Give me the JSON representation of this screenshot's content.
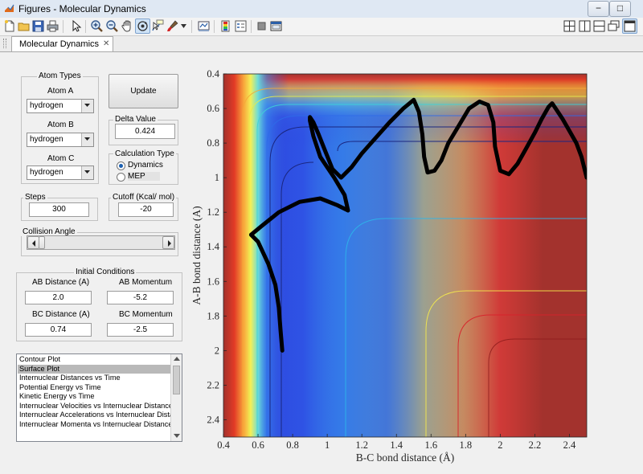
{
  "window": {
    "title": "Figures - Molecular Dynamics",
    "min_label": "−",
    "max_label": "□",
    "close_label": "✕"
  },
  "toolbar": {
    "items": [
      "new-figure-icon",
      "open-icon",
      "save-icon",
      "print-icon",
      "pointer-icon",
      "zoom-in-icon",
      "zoom-out-icon",
      "pan-hand-icon",
      "rotate-3d-icon",
      "data-cursor-icon",
      "brush-icon",
      "link-plot-icon",
      "colorbar-icon",
      "legend-icon",
      "hide-plot-tools-icon",
      "show-plot-tools-icon"
    ],
    "right_items": [
      "tile-icon",
      "left-right-icon",
      "top-bottom-icon",
      "float-icon",
      "dock-icon"
    ]
  },
  "tab": {
    "label": "Molecular Dynamics",
    "close": "✕"
  },
  "atom_types": {
    "title": "Atom Types",
    "atom_a_label": "Atom A",
    "atom_a_value": "hydrogen",
    "atom_b_label": "Atom B",
    "atom_b_value": "hydrogen",
    "atom_c_label": "Atom C",
    "atom_c_value": "hydrogen"
  },
  "update_button": "Update",
  "delta": {
    "title": "Delta Value",
    "value": "0.424"
  },
  "calc_type": {
    "title": "Calculation Type",
    "options": [
      "Dynamics",
      "MEP"
    ],
    "selected": "Dynamics"
  },
  "steps": {
    "title": "Steps",
    "value": "300"
  },
  "cutoff": {
    "title": "Cutoff (Kcal/ mol)",
    "value": "-20"
  },
  "collision": {
    "title": "Collision Angle",
    "slider_fraction": 0.0
  },
  "initial": {
    "title": "Initial Conditions",
    "ab_distance_label": "AB Distance (A)",
    "ab_distance": "2.0",
    "ab_momentum_label": "AB Momentum",
    "ab_momentum": "-5.2",
    "bc_distance_label": "BC Distance (A)",
    "bc_distance": "0.74",
    "bc_momentum_label": "BC Momentum",
    "bc_momentum": "-2.5"
  },
  "plot_list": {
    "items": [
      "Contour Plot",
      "Surface Plot",
      "Internuclear Distances vs Time",
      "Potential Energy vs Time",
      "Kinetic Energy vs Time",
      "Internuclear Velocities vs Internuclear Distances",
      "Internuclear Accelerations vs Internuclear Distances",
      "Internuclear Momenta vs Internuclear Distances"
    ],
    "selected": "Surface Plot"
  },
  "chart_data": {
    "type": "heatmap",
    "xlabel": "B-C bond distance (Å)",
    "ylabel": "A-B bond distance (Å)",
    "xlim": [
      0.4,
      2.5
    ],
    "ylim": [
      0.4,
      2.5
    ],
    "y_reversed": true,
    "xticks": [
      "0.4",
      "0.6",
      "0.8",
      "1",
      "1.2",
      "1.4",
      "1.6",
      "1.8",
      "2",
      "2.2",
      "2.4"
    ],
    "yticks": [
      "0.4",
      "0.6",
      "0.8",
      "1",
      "1.2",
      "1.4",
      "1.6",
      "1.8",
      "2",
      "2.2",
      "2.4"
    ],
    "colormap": "jet",
    "trajectory": {
      "x": [
        0.74,
        0.73,
        0.72,
        0.7,
        0.66,
        0.6,
        0.56,
        0.62,
        0.72,
        0.84,
        0.96,
        1.06,
        1.12,
        1.1,
        1.04,
        0.96,
        0.92,
        0.9,
        0.9,
        0.92,
        0.95,
        0.99,
        1.03,
        1.08,
        1.14,
        1.2,
        1.28,
        1.36,
        1.44,
        1.5,
        1.53,
        1.55,
        1.56,
        1.58,
        1.62,
        1.66,
        1.7,
        1.76,
        1.82,
        1.88,
        1.93,
        1.96,
        1.97,
        2.0,
        2.05,
        2.1,
        2.15,
        2.2,
        2.24,
        2.28,
        2.3,
        2.32,
        2.36,
        2.4,
        2.44,
        2.47,
        2.49,
        2.5
      ],
      "y": [
        2.0,
        1.88,
        1.75,
        1.62,
        1.5,
        1.37,
        1.33,
        1.28,
        1.2,
        1.14,
        1.12,
        1.16,
        1.19,
        1.1,
        1.0,
        0.88,
        0.76,
        0.67,
        0.65,
        0.68,
        0.75,
        0.85,
        0.95,
        1.0,
        0.94,
        0.86,
        0.77,
        0.68,
        0.6,
        0.55,
        0.62,
        0.75,
        0.88,
        0.97,
        0.96,
        0.9,
        0.8,
        0.7,
        0.6,
        0.56,
        0.58,
        0.68,
        0.82,
        0.96,
        0.98,
        0.92,
        0.83,
        0.74,
        0.66,
        0.59,
        0.57,
        0.6,
        0.66,
        0.73,
        0.8,
        0.88,
        0.96,
        1.0
      ]
    }
  }
}
